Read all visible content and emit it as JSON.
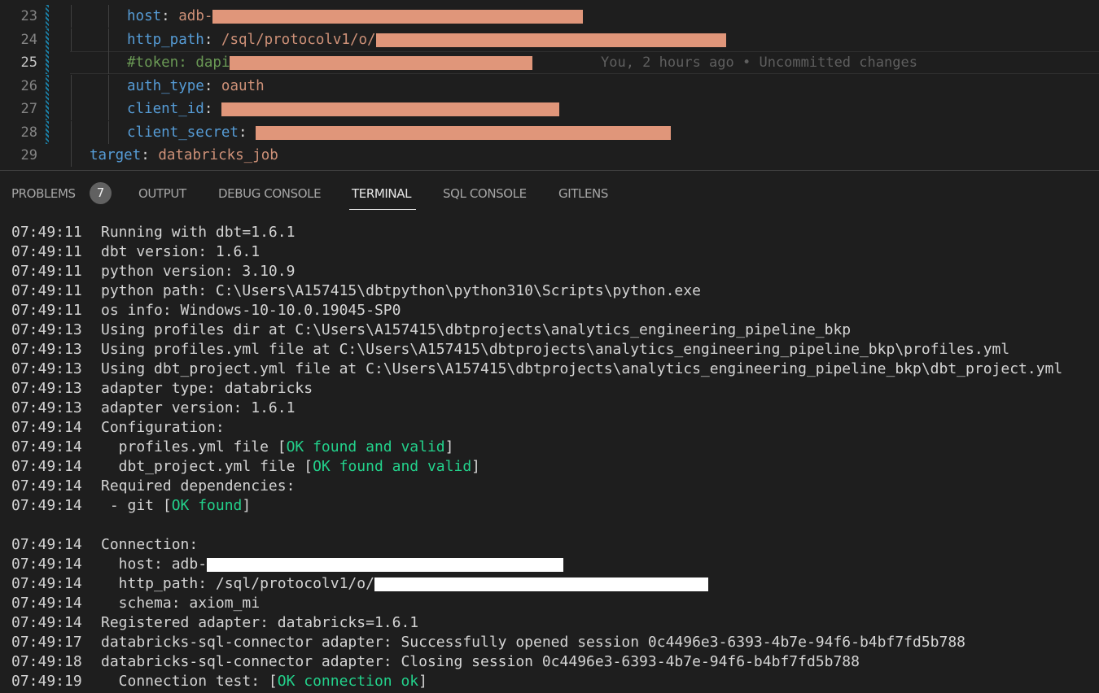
{
  "editor": {
    "lines": [
      {
        "num": "23",
        "key": "host",
        "colon": ":",
        "value_prefix": "adb-",
        "redacted": true,
        "comment": false
      },
      {
        "num": "24",
        "key": "http_path",
        "colon": ":",
        "value_prefix": "/sql/protocolv1/o/",
        "redacted": true,
        "comment": false
      },
      {
        "num": "25",
        "key": "#token:",
        "colon": "",
        "value_prefix": "dapi",
        "redacted": true,
        "comment": true,
        "blame": "You, 2 hours ago • Uncommitted changes"
      },
      {
        "num": "26",
        "key": "auth_type",
        "colon": ":",
        "value_prefix": "oauth",
        "redacted": false,
        "comment": false
      },
      {
        "num": "27",
        "key": "client_id",
        "colon": ":",
        "value_prefix": "",
        "redacted": true,
        "comment": false
      },
      {
        "num": "28",
        "key": "client_secret",
        "colon": ":",
        "value_prefix": "",
        "redacted": true,
        "comment": false
      },
      {
        "num": "29",
        "key": "target",
        "colon": ":",
        "value_prefix": "databricks_job",
        "redacted": false,
        "comment": false
      }
    ]
  },
  "panel": {
    "tabs": [
      {
        "label": "PROBLEMS",
        "badge": "7"
      },
      {
        "label": "OUTPUT"
      },
      {
        "label": "DEBUG CONSOLE"
      },
      {
        "label": "TERMINAL",
        "active": true
      },
      {
        "label": "SQL CONSOLE"
      },
      {
        "label": "GITLENS"
      }
    ]
  },
  "terminal": {
    "lines": [
      {
        "ts": "07:49:11",
        "text": "Running with dbt=1.6.1"
      },
      {
        "ts": "07:49:11",
        "text": "dbt version: 1.6.1"
      },
      {
        "ts": "07:49:11",
        "text": "python version: 3.10.9"
      },
      {
        "ts": "07:49:11",
        "text": "python path: C:\\Users\\A157415\\dbtpython\\python310\\Scripts\\python.exe"
      },
      {
        "ts": "07:49:11",
        "text": "os info: Windows-10-10.0.19045-SP0"
      },
      {
        "ts": "07:49:13",
        "text": "Using profiles dir at C:\\Users\\A157415\\dbtprojects\\analytics_engineering_pipeline_bkp"
      },
      {
        "ts": "07:49:13",
        "text": "Using profiles.yml file at C:\\Users\\A157415\\dbtprojects\\analytics_engineering_pipeline_bkp\\profiles.yml"
      },
      {
        "ts": "07:49:13",
        "text": "Using dbt_project.yml file at C:\\Users\\A157415\\dbtprojects\\analytics_engineering_pipeline_bkp\\dbt_project.yml"
      },
      {
        "ts": "07:49:13",
        "text": "adapter type: databricks"
      },
      {
        "ts": "07:49:13",
        "text": "adapter version: 1.6.1"
      },
      {
        "ts": "07:49:14",
        "text": "Configuration:"
      },
      {
        "ts": "07:49:14",
        "text": "  profiles.yml file [",
        "ok": "OK found and valid",
        "after": "]"
      },
      {
        "ts": "07:49:14",
        "text": "  dbt_project.yml file [",
        "ok": "OK found and valid",
        "after": "]"
      },
      {
        "ts": "07:49:14",
        "text": "Required dependencies:"
      },
      {
        "ts": "07:49:14",
        "text": " - git [",
        "ok": "OK found",
        "after": "]"
      },
      {
        "ts": "",
        "text": ""
      },
      {
        "ts": "07:49:14",
        "text": "Connection:"
      },
      {
        "ts": "07:49:14",
        "text": "  host: adb-",
        "redacted": true
      },
      {
        "ts": "07:49:14",
        "text": "  http_path: /sql/protocolv1/o/",
        "redacted": true
      },
      {
        "ts": "07:49:14",
        "text": "  schema: axiom_mi"
      },
      {
        "ts": "07:49:14",
        "text": "Registered adapter: databricks=1.6.1"
      },
      {
        "ts": "07:49:17",
        "text": "databricks-sql-connector adapter: Successfully opened session 0c4496e3-6393-4b7e-94f6-b4bf7fd5b788"
      },
      {
        "ts": "07:49:18",
        "text": "databricks-sql-connector adapter: Closing session 0c4496e3-6393-4b7e-94f6-b4bf7fd5b788"
      },
      {
        "ts": "07:49:19",
        "text": "  Connection test: [",
        "ok": "OK connection ok",
        "after": "]"
      }
    ]
  }
}
